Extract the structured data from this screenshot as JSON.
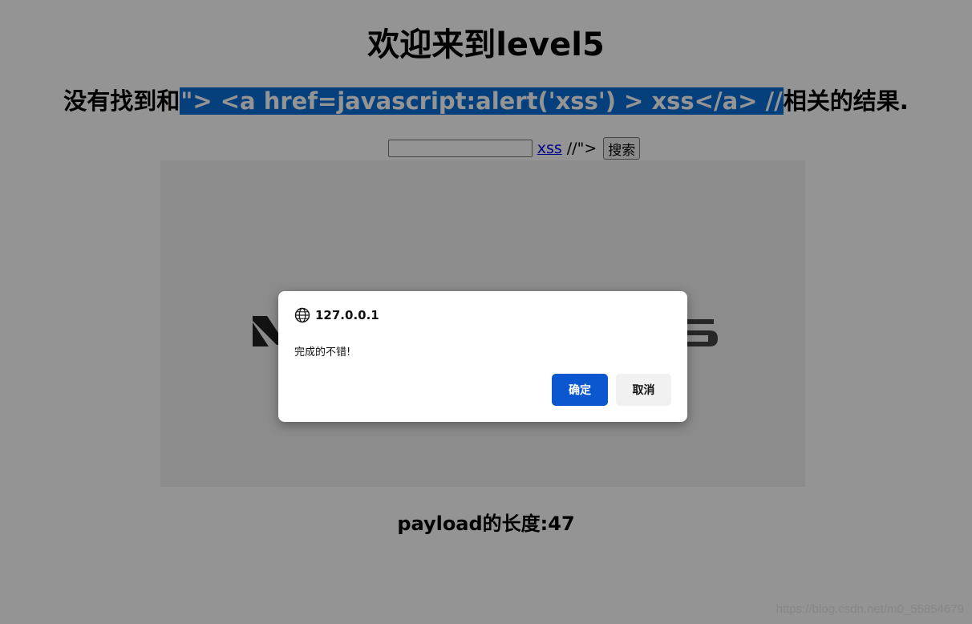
{
  "page": {
    "title": "欢迎来到level5",
    "subtitle_prefix": "没有找到和",
    "subtitle_query": "\"> <a href=javascript:alert('xss') > xss</a> //",
    "subtitle_suffix": "相关的结果.",
    "search_input_value": "",
    "injected_link_text": "xss",
    "injected_tail_text": "//\">",
    "search_button_label": "搜索",
    "payload_length_text": "payload的长度:47"
  },
  "dialog": {
    "origin": "127.0.0.1",
    "message": "完成的不错!",
    "ok_label": "确定",
    "cancel_label": "取消"
  },
  "watermark": "https://blog.csdn.net/m0_55854679",
  "colors": {
    "accent": "#0b57d0",
    "selection": "#0c6fd6",
    "link": "#0000ee"
  }
}
